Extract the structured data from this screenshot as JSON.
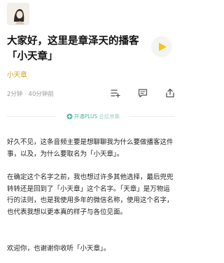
{
  "episode": {
    "title": "大家好，这里是章泽天的播客「小天章」",
    "author": "小天章",
    "duration": "2分钟",
    "listens": "40分钟前",
    "meta_separator": " · "
  },
  "promo": {
    "prefix": "开通PLUS",
    "suffix": "总结单集"
  },
  "content": {
    "paragraphs": [
      "好久不见，这条音频主要是想聊聊我为什么要做播客这件事，以及，为什么要取名为「小天章」。",
      "在确定这个名字之前，我也想过许多其他选择，最后兜兜转转还是回到了「小天章」这个名字。「天章」是万物运行的法则，也是我使用多年的微信名称，使用这个名字，也代表我想以更本真的样子与各位见面。",
      "欢迎你，也谢谢你收听「小天章」。"
    ]
  },
  "icons": {
    "avatar": "avatar-illustration",
    "play": "play-icon",
    "playlist_add": "playlist-add-icon",
    "comment": "comment-icon",
    "share": "share-icon",
    "plus": "plus-badge-icon"
  },
  "colors": {
    "author": "#c8a11a",
    "play_triangle": "#f5c518",
    "promo_text": "#4fb6a8"
  }
}
